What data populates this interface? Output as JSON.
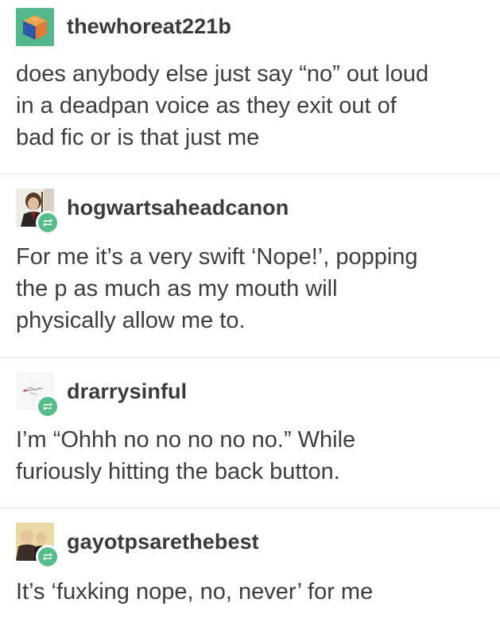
{
  "posts": [
    {
      "username": "thewhoreat221b",
      "avatar_icon": "cube-avatar-icon",
      "reblog": false,
      "lines": [
        "does anybody else just say “no” out loud",
        "in a deadpan voice as they exit out of",
        "bad fic or is that just me"
      ]
    },
    {
      "username": "hogwartsaheadcanon",
      "avatar_icon": "portrait-avatar-icon",
      "reblog": true,
      "lines": [
        "For me it’s a very swift ‘Nope!’, popping",
        "the p as much as my mouth will",
        "physically allow me to."
      ]
    },
    {
      "username": "drarrysinful",
      "avatar_icon": "sketch-avatar-icon",
      "reblog": true,
      "lines": [
        "I’m “Ohhh no no no no no.” While",
        "furiously hitting the back button."
      ]
    },
    {
      "username": "gayotpsarethebest",
      "avatar_icon": "couple-avatar-icon",
      "reblog": true,
      "lines": [
        "It’s ‘fuxking nope, no, never’ for me"
      ]
    }
  ],
  "colors": {
    "reblog_badge": "#56bc8a",
    "divider": "#e3e3e3",
    "text": "#3d3d3d"
  },
  "icons": {
    "reblog": "reblog-icon"
  }
}
